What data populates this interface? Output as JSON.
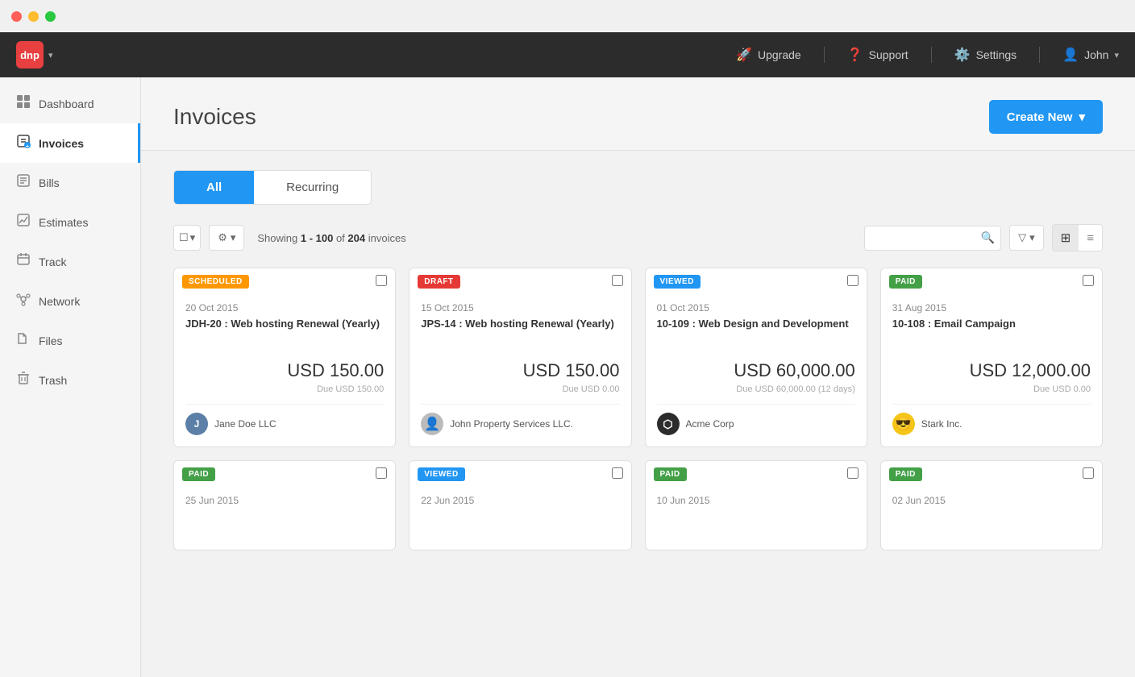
{
  "titlebar": {
    "dots": [
      "red",
      "yellow",
      "green"
    ]
  },
  "topnav": {
    "logo": "dnp",
    "upgrade_label": "Upgrade",
    "support_label": "Support",
    "settings_label": "Settings",
    "user_label": "John"
  },
  "sidebar": {
    "items": [
      {
        "id": "dashboard",
        "label": "Dashboard",
        "icon": "▦",
        "active": false
      },
      {
        "id": "invoices",
        "label": "Invoices",
        "icon": "＋",
        "active": true
      },
      {
        "id": "bills",
        "label": "Bills",
        "icon": "📄",
        "active": false
      },
      {
        "id": "estimates",
        "label": "Estimates",
        "icon": "📊",
        "active": false
      },
      {
        "id": "track",
        "label": "Track",
        "icon": "📋",
        "active": false
      },
      {
        "id": "network",
        "label": "Network",
        "icon": "✦",
        "active": false
      },
      {
        "id": "files",
        "label": "Files",
        "icon": "📁",
        "active": false
      },
      {
        "id": "trash",
        "label": "Trash",
        "icon": "🗑",
        "active": false
      }
    ]
  },
  "page": {
    "title": "Invoices",
    "create_new_label": "Create New"
  },
  "tabs": [
    {
      "id": "all",
      "label": "All",
      "active": true
    },
    {
      "id": "recurring",
      "label": "Recurring",
      "active": false
    }
  ],
  "toolbar": {
    "showing_text": "Showing",
    "range": "1 - 100",
    "of": "of",
    "total": "204",
    "invoices_label": "invoices",
    "search_placeholder": "",
    "filter_label": "Filter"
  },
  "cards": [
    {
      "status": "SCHEDULED",
      "status_class": "scheduled",
      "date": "20 Oct 2015",
      "id_title": "JDH-20 : Web hosting Renewal (Yearly)",
      "amount": "USD 150.00",
      "due": "Due USD 150.00",
      "client_name": "Jane Doe LLC",
      "client_avatar_letter": "J",
      "client_avatar_color": "#5b7fa6"
    },
    {
      "status": "DRAFT",
      "status_class": "draft",
      "date": "15 Oct 2015",
      "id_title": "JPS-14 : Web hosting Renewal (Yearly)",
      "amount": "USD 150.00",
      "due": "Due USD 0.00",
      "client_name": "John Property Services LLC.",
      "client_avatar_letter": "👤",
      "client_avatar_color": "#aaa"
    },
    {
      "status": "VIEWED",
      "status_class": "viewed",
      "date": "01 Oct 2015",
      "id_title": "10-109 : Web Design and Development",
      "amount": "USD 60,000.00",
      "due": "Due USD 60,000.00 (12 days)",
      "client_name": "Acme Corp",
      "client_avatar_letter": "⬡",
      "client_avatar_color": "#333"
    },
    {
      "status": "PAID",
      "status_class": "paid",
      "date": "31 Aug 2015",
      "id_title": "10-108 : Email Campaign",
      "amount": "USD 12,000.00",
      "due": "Due USD 0.00",
      "client_name": "Stark Inc.",
      "client_avatar_letter": "😎",
      "client_avatar_color": "#f5c518"
    },
    {
      "status": "PAID",
      "status_class": "paid",
      "date": "25 Jun 2015",
      "id_title": "",
      "amount": "",
      "due": "",
      "client_name": "",
      "client_avatar_letter": "",
      "client_avatar_color": "#aaa"
    },
    {
      "status": "VIEWED",
      "status_class": "viewed",
      "date": "22 Jun 2015",
      "id_title": "",
      "amount": "",
      "due": "",
      "client_name": "",
      "client_avatar_letter": "",
      "client_avatar_color": "#aaa"
    },
    {
      "status": "PAID",
      "status_class": "paid",
      "date": "10 Jun 2015",
      "id_title": "",
      "amount": "",
      "due": "",
      "client_name": "",
      "client_avatar_letter": "",
      "client_avatar_color": "#aaa"
    },
    {
      "status": "PAID",
      "status_class": "paid",
      "date": "02 Jun 2015",
      "id_title": "",
      "amount": "",
      "due": "",
      "client_name": "",
      "client_avatar_letter": "",
      "client_avatar_color": "#aaa"
    }
  ]
}
